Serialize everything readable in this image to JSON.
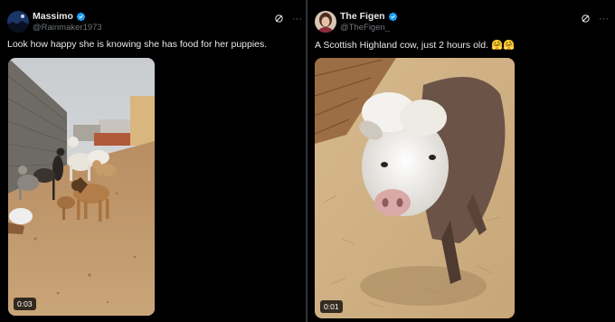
{
  "tweets": [
    {
      "author_name": "Massimo",
      "author_handle": "@Rainmaker1973",
      "text": "Look how happy she is knowing she has food for her puppies.",
      "video_timestamp": "0:03",
      "verified": true,
      "verified_color": "#1d9bf0"
    },
    {
      "author_name": "The Figen",
      "author_handle": "@TheFigen_",
      "text": "A Scottish Highland cow, just 2 hours old. 🤗🤗",
      "video_timestamp": "0:01",
      "verified": true,
      "verified_color": "#1d9bf0"
    }
  ],
  "icons": {
    "verified": "verified-badge-icon",
    "grok": "grok-icon",
    "more": "more-options-icon"
  }
}
